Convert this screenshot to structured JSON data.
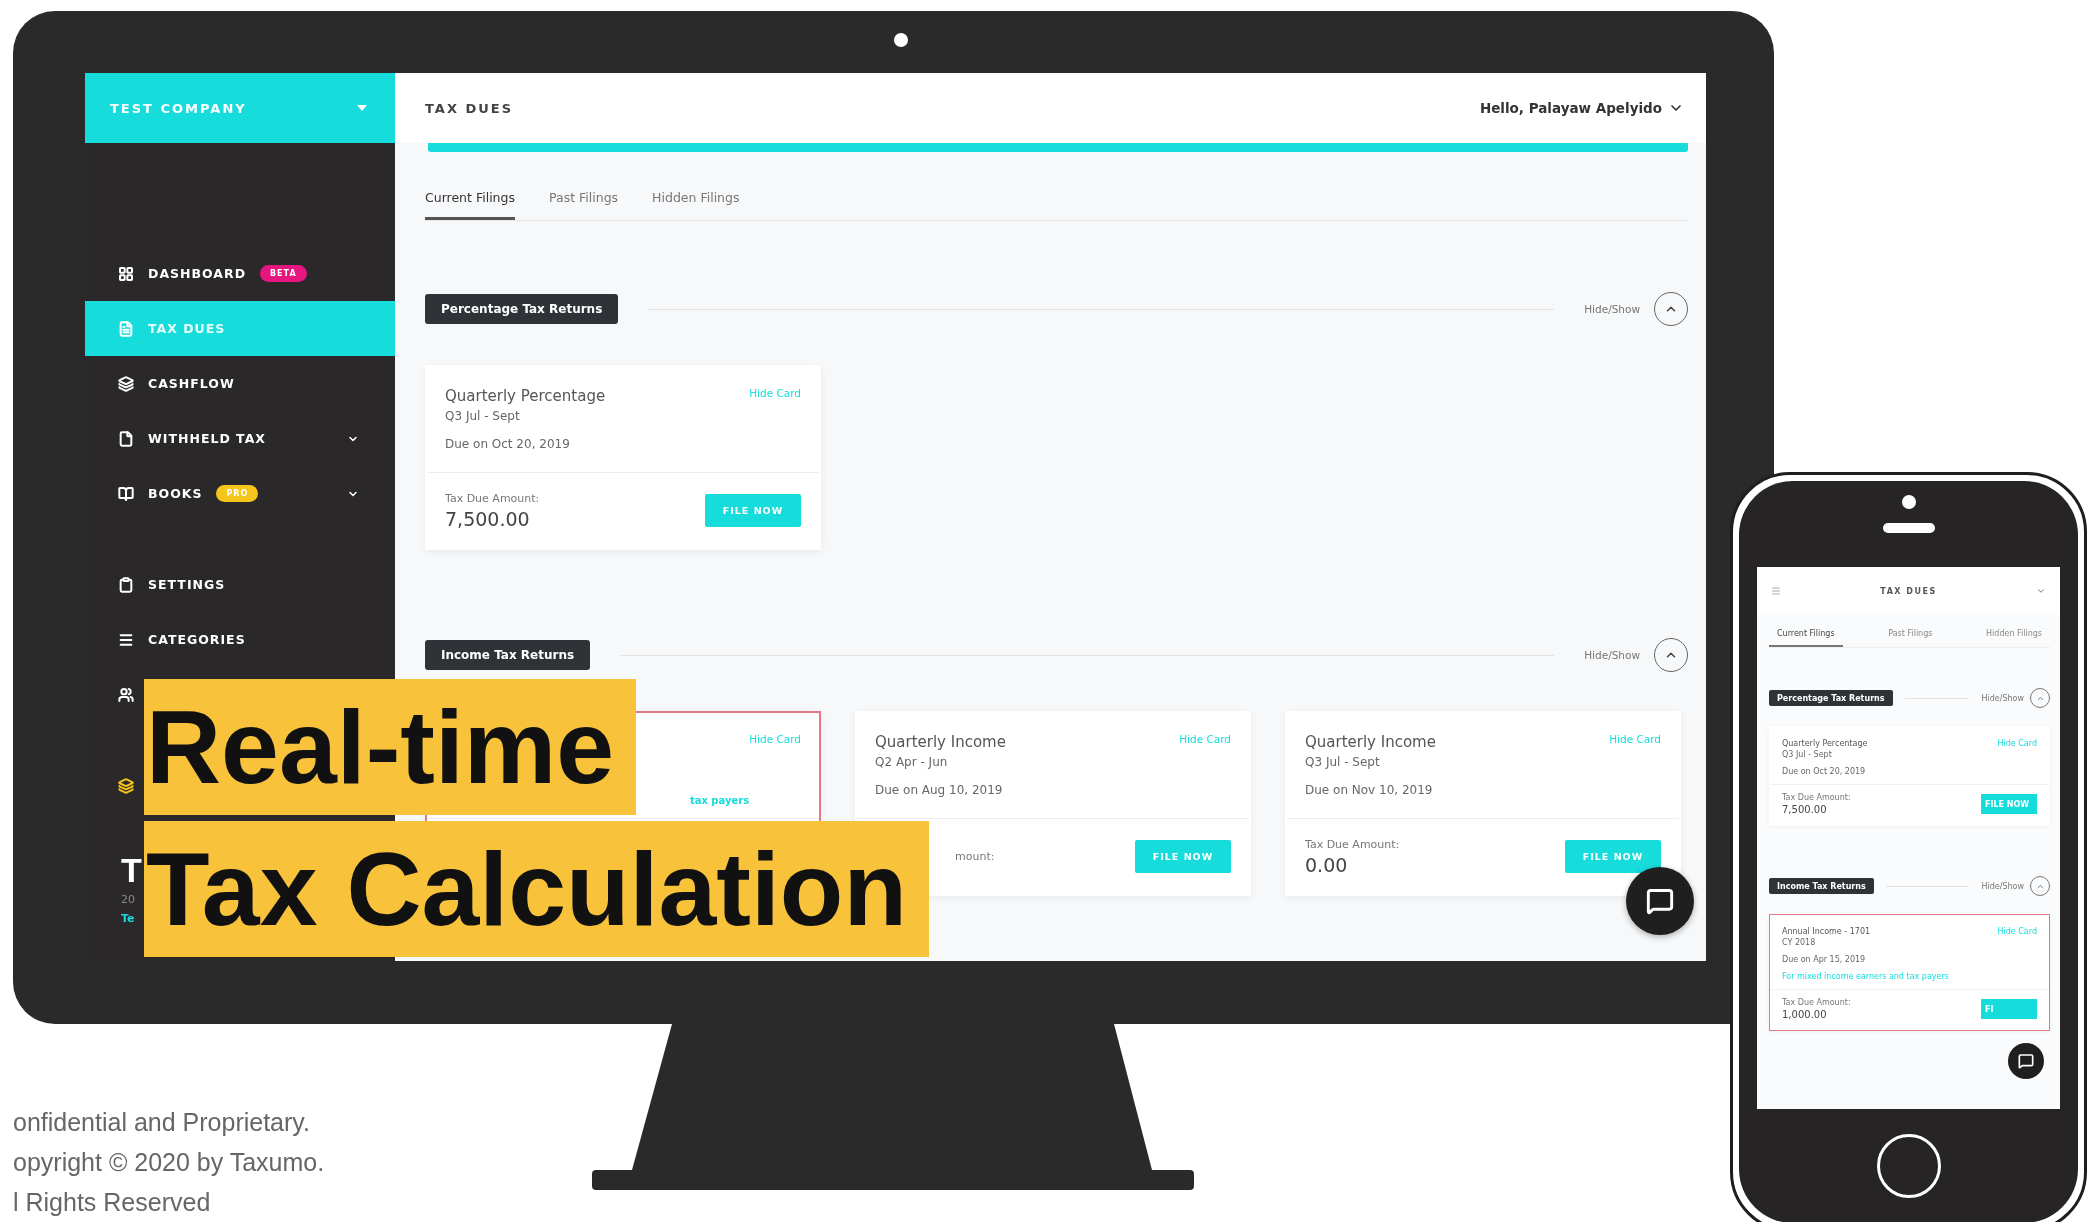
{
  "sidebar": {
    "company": "TEST COMPANY",
    "groups": [
      {
        "items": [
          {
            "label": "DASHBOARD",
            "badge": {
              "text": "BETA",
              "color": "#e6157f"
            },
            "selected": false,
            "expandable": false,
            "color": "#ffffff"
          },
          {
            "label": "TAX DUES",
            "selected": true,
            "expandable": false,
            "color": "#ffffff"
          },
          {
            "label": "CASHFLOW",
            "selected": false,
            "expandable": false,
            "color": "#ffffff"
          },
          {
            "label": "WITHHELD TAX",
            "selected": false,
            "expandable": true,
            "color": "#ffffff"
          },
          {
            "label": "BOOKS",
            "badge": {
              "text": "PRO",
              "color": "#f6c51b"
            },
            "selected": false,
            "expandable": true,
            "color": "#ffffff"
          }
        ]
      },
      {
        "items": [
          {
            "label": "SETTINGS",
            "selected": false,
            "expandable": false,
            "color": "#ffffff"
          },
          {
            "label": "CATEGORIES",
            "selected": false,
            "expandable": false,
            "color": "#ffffff"
          },
          {
            "selected": false,
            "expandable": false,
            "color": "#ffffff"
          }
        ]
      },
      {
        "items": [
          {
            "selected": false,
            "expandable": false,
            "color": "#f6c51b"
          }
        ]
      }
    ],
    "footer": {
      "title": "T",
      "subtitle": "20",
      "link": "Te"
    }
  },
  "header": {
    "title": "TAX DUES",
    "user": "Hello, Palayaw Apelyido"
  },
  "tabs": [
    {
      "label": "Current Filings",
      "selected": true
    },
    {
      "label": "Past Filings",
      "selected": false
    },
    {
      "label": "Hidden Filings",
      "selected": false
    }
  ],
  "sections": [
    {
      "title": "Percentage Tax Returns",
      "toggle": "Hide/Show",
      "expanded": true,
      "cards": [
        {
          "title": "Quarterly Percentage",
          "period": "Q3 Jul - Sept",
          "due": "Due on Oct 20, 2019",
          "hide": "Hide Card",
          "amount_label": "Tax Due Amount:",
          "amount": "7,500.00",
          "button": "FILE NOW",
          "highlighted": false
        }
      ]
    },
    {
      "title": "Income Tax Returns",
      "toggle": "Hide/Show",
      "expanded": true,
      "cards": [
        {
          "hide": "Hide Card",
          "link": "tax payers",
          "highlighted": true
        },
        {
          "title": "Quarterly Income",
          "period": "Q2 Apr - Jun",
          "due": "Due on Aug 10, 2019",
          "hide": "Hide Card",
          "amount_label": "mount:",
          "button": "FILE NOW",
          "highlighted": false
        },
        {
          "title": "Quarterly Income",
          "period": "Q3 Jul - Sept",
          "due": "Due on Nov 10, 2019",
          "hide": "Hide Card",
          "amount_label": "Tax Due Amount:",
          "amount": "0.00",
          "button": "FILE NOW",
          "highlighted": false
        }
      ]
    }
  ],
  "banner": [
    "Real-time",
    "Tax Calculation"
  ],
  "footer_lines": [
    "onfidential and Proprietary.",
    "opyright © 2020 by Taxumo.",
    "l Rights Reserved"
  ],
  "phone": {
    "title": "TAX DUES",
    "tabs": [
      {
        "label": "Current Filings",
        "selected": true
      },
      {
        "label": "Past Filings",
        "selected": false
      },
      {
        "label": "Hidden Filings",
        "selected": false
      }
    ],
    "sections": [
      {
        "title": "Percentage Tax Returns",
        "toggle": "Hide/Show",
        "expanded": true,
        "cards": [
          {
            "title": "Quarterly Percentage",
            "period": "Q3 Jul - Sept",
            "due": "Due on Oct 20, 2019",
            "hide": "Hide Card",
            "amount_label": "Tax Due Amount:",
            "amount": "7,500.00",
            "button": "FILE NOW",
            "highlighted": false
          }
        ]
      },
      {
        "title": "Income Tax Returns",
        "toggle": "Hide/Show",
        "expanded": true,
        "cards": [
          {
            "title": "Annual Income - 1701",
            "period": "CY 2018",
            "due": "Due on Apr 15, 2019",
            "hide": "Hide Card",
            "link": "For mixed income earners and tax payers",
            "amount_label": "Tax Due Amount:",
            "amount": "1,000.00",
            "button": "FI",
            "highlighted": true
          }
        ]
      }
    ]
  }
}
